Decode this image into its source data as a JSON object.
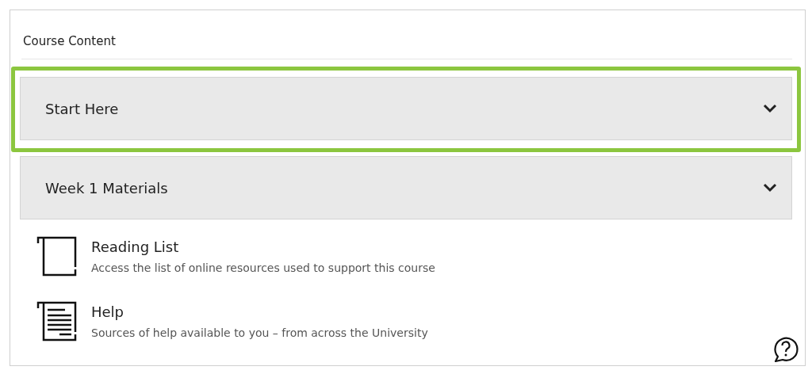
{
  "heading": "Course Content",
  "sections": [
    {
      "label": "Start Here",
      "highlighted": true
    },
    {
      "label": "Week 1 Materials",
      "highlighted": false
    }
  ],
  "items": [
    {
      "kind": "book",
      "title": "Reading List",
      "description": "Access the list of online resources used to support this course"
    },
    {
      "kind": "document",
      "title": "Help",
      "description": "Sources of help available to you – from across the University"
    }
  ]
}
